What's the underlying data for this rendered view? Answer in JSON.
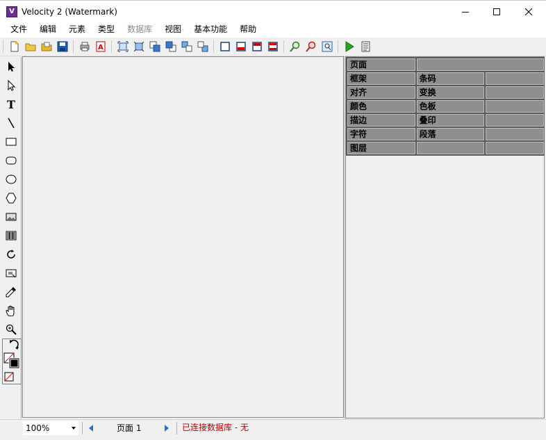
{
  "window": {
    "title": "Velocity 2 (Watermark)",
    "app_icon_letter": "V",
    "controls": [
      "minimize-icon",
      "maximize-icon",
      "close-icon"
    ]
  },
  "menu": {
    "items": [
      {
        "label": "文件",
        "enabled": true
      },
      {
        "label": "编辑",
        "enabled": true
      },
      {
        "label": "元素",
        "enabled": true
      },
      {
        "label": "类型",
        "enabled": true
      },
      {
        "label": "数据库",
        "enabled": false
      },
      {
        "label": "视图",
        "enabled": true
      },
      {
        "label": "基本功能",
        "enabled": true
      },
      {
        "label": "帮助",
        "enabled": true
      }
    ]
  },
  "toolbar": {
    "icons": [
      "new-file-icon",
      "open-folder-icon",
      "open-folder-2-icon",
      "save-icon",
      "print-icon",
      "pdf-icon",
      "fit-frame-icon",
      "fit-frame-2-icon",
      "bring-forward-icon",
      "send-backward-icon",
      "bring-front-icon",
      "send-back-icon",
      "frame-icon",
      "frame-bottom-icon",
      "frame-top-icon",
      "frame-both-icon",
      "zoom-in-icon",
      "zoom-out-icon",
      "zoom-fit-icon",
      "run-icon",
      "report-icon"
    ]
  },
  "left_tools": [
    "select-arrow-icon",
    "direct-select-icon",
    "text-tool-icon",
    "line-tool-icon",
    "rectangle-tool-icon",
    "rounded-rect-tool-icon",
    "ellipse-tool-icon",
    "polygon-tool-icon",
    "image-tool-icon",
    "barcode-tool-icon",
    "rotate-tool-icon",
    "crop-tool-icon",
    "eyedropper-tool-icon",
    "hand-tool-icon",
    "zoom-tool-icon"
  ],
  "properties": {
    "rows": [
      [
        "页面",
        ""
      ],
      [
        "框架",
        "条码",
        ""
      ],
      [
        "对齐",
        "变换",
        ""
      ],
      [
        "颜色",
        "色板",
        ""
      ],
      [
        "描边",
        "叠印",
        ""
      ],
      [
        "字符",
        "段落",
        ""
      ],
      [
        "图层",
        "",
        ""
      ]
    ]
  },
  "status": {
    "zoom": "100%",
    "page_label": "页面 1",
    "db_status": "已连接数据库 - 无",
    "db_status_color": "#c00000"
  }
}
